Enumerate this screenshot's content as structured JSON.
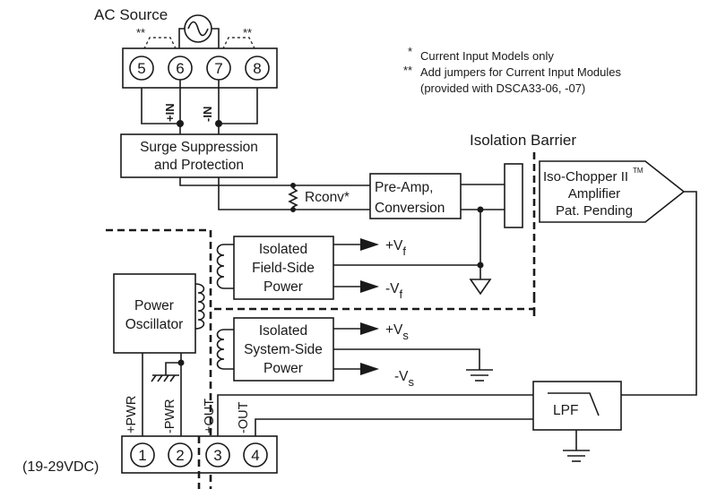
{
  "title_ac_source": "AC Source",
  "notes": {
    "note1_marker": "*",
    "note1_text": "Current Input Models only",
    "note2_marker": "**",
    "note2_text": "Add jumpers for Current Input Modules",
    "note3_text": "(provided with DSCA33-06, -07)"
  },
  "jumper_marks": [
    "**",
    "**"
  ],
  "input_terminals": [
    "5",
    "6",
    "7",
    "8"
  ],
  "input_labels": {
    "plus": "+IN",
    "minus": "-IN"
  },
  "blocks": {
    "surge": [
      "Surge Suppression",
      "and Protection"
    ],
    "rconv": "Rconv*",
    "preamp": [
      "Pre-Amp,",
      "Conversion"
    ],
    "isolation_barrier": "Isolation Barrier",
    "chopper": [
      "Iso-Chopper II",
      "Amplifier",
      "Pat. Pending"
    ],
    "chopper_tm": "TM",
    "field_power": [
      "Isolated",
      "Field-Side",
      "Power"
    ],
    "system_power": [
      "Isolated",
      "System-Side",
      "Power"
    ],
    "oscillator": [
      "Power",
      "Oscillator"
    ],
    "lpf": "LPF"
  },
  "rails": {
    "field_pos": "+V",
    "field_pos_sub": "f",
    "field_neg": "-V",
    "field_neg_sub": "f",
    "sys_pos": "+V",
    "sys_pos_sub": "s",
    "sys_neg": "-V",
    "sys_neg_sub": "s"
  },
  "output_terminals": [
    "1",
    "2",
    "3",
    "4"
  ],
  "output_labels": {
    "pwr_plus": "+PWR",
    "pwr_minus": "-PWR",
    "out_plus": "+OUT",
    "out_minus": "-OUT"
  },
  "supply_range": "(19-29VDC)"
}
